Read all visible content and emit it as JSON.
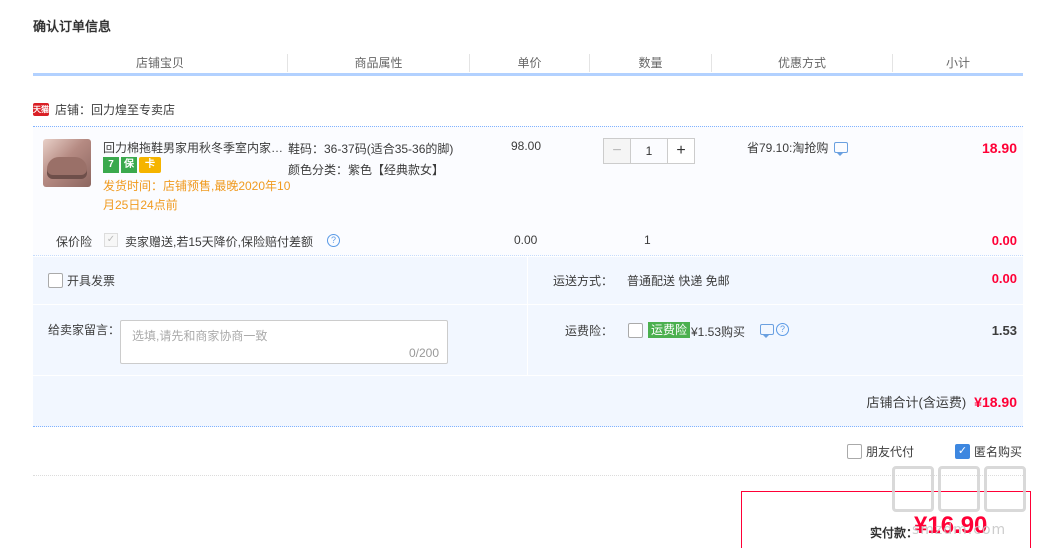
{
  "page": {
    "title": "确认订单信息"
  },
  "columns": [
    "店铺宝贝",
    "商品属性",
    "单价",
    "数量",
    "优惠方式",
    "小计"
  ],
  "shop": {
    "tmall_badge": "天猫",
    "label": "店铺：回力煌至专卖店"
  },
  "item": {
    "name": "回力棉拖鞋男家用秋冬季室内家…",
    "badges": [
      "7",
      "保",
      "卡"
    ],
    "ship_time": "发货时间：店铺预售,最晚2020年10月25日24点前",
    "attr_size": "鞋码：36-37码(适合35-36的脚)",
    "attr_color": "颜色分类：紫色【经典款女】",
    "price": "98.00",
    "qty_minus": "−",
    "qty_value": "1",
    "qty_plus": "+",
    "promo": "省79.10:淘抢购",
    "subtotal": "18.90"
  },
  "insurance": {
    "label": "保价险",
    "check": "✓",
    "desc": "卖家赠送,若15天降价,保险赔付差额",
    "help": "?",
    "price": "0.00",
    "qty": "1",
    "subtotal": "0.00"
  },
  "invoice": {
    "label": "开具发票"
  },
  "shipping": {
    "label": "运送方式：",
    "value": "普通配送 快递 免邮",
    "fee": "0.00"
  },
  "message": {
    "label": "给卖家留言：",
    "placeholder": "选填,请先和商家协商一致",
    "count": "0/200"
  },
  "freight": {
    "label": "运费险：",
    "tag": "运费险",
    "text": "¥1.53购买",
    "help": "?",
    "fee": "1.53"
  },
  "shop_total": {
    "label": "店铺合计(含运费)",
    "amount": "¥18.90"
  },
  "options": {
    "friend_pay": "朋友代付",
    "anonymous": "匿名购买",
    "anon_check": "✓"
  },
  "payment": {
    "label": "实付款：",
    "amount": "¥16.90"
  },
  "watermark": {
    "text": "smzdm.com"
  },
  "colors": {
    "accent_red": "#ff0036",
    "blue_line": "#80b2ff",
    "header_border": "#b2d1ff",
    "ship_orange": "#f09a1f"
  }
}
